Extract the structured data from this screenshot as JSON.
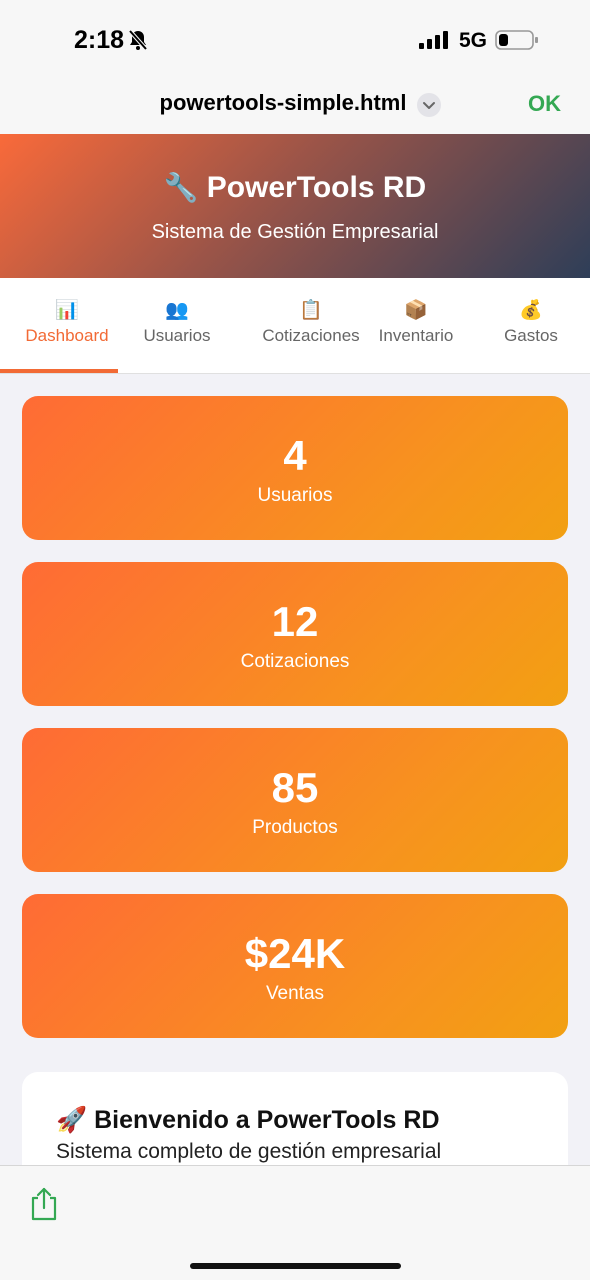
{
  "status_bar": {
    "time": "2:18",
    "network": "5G",
    "icons": [
      "bell-slash-icon",
      "signal-icon",
      "battery-icon"
    ]
  },
  "browser": {
    "document_title": "powertools-simple.html",
    "done_label": "OK",
    "accent_color": "#34a853"
  },
  "app": {
    "title_icon": "🔧",
    "title": "PowerTools RD",
    "subtitle": "Sistema de Gestión Empresarial",
    "accent_color": "#f26a35"
  },
  "tabs": [
    {
      "icon": "📊",
      "label": "Dashboard",
      "active": true
    },
    {
      "icon": "👥",
      "label": "Usuarios",
      "active": false
    },
    {
      "icon": "📋",
      "label": "Cotizaciones",
      "active": false
    },
    {
      "icon": "📦",
      "label": "Inventario",
      "active": false
    },
    {
      "icon": "💰",
      "label": "Gastos",
      "active": false
    }
  ],
  "stats": [
    {
      "value": "4",
      "label": "Usuarios"
    },
    {
      "value": "12",
      "label": "Cotizaciones"
    },
    {
      "value": "85",
      "label": "Productos"
    },
    {
      "value": "$24K",
      "label": "Ventas"
    }
  ],
  "welcome": {
    "icon": "🚀",
    "title": "Bienvenido a PowerTools RD",
    "text": "Sistema completo de gestión empresarial"
  }
}
